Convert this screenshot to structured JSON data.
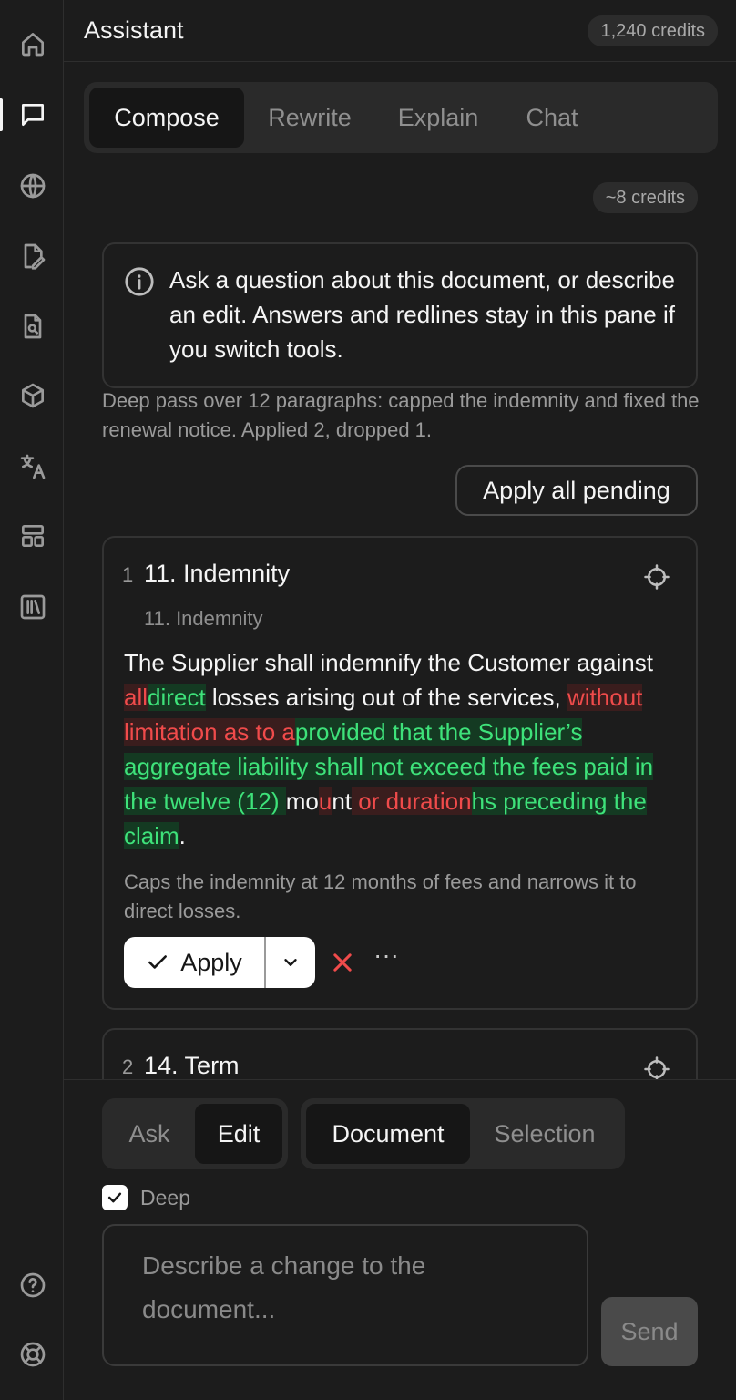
{
  "header": {
    "title": "Assistant",
    "credits": "1,240 credits"
  },
  "tabs": [
    {
      "label": "Compose",
      "active": true
    },
    {
      "label": "Rewrite",
      "active": false
    },
    {
      "label": "Explain",
      "active": false
    },
    {
      "label": "Chat",
      "active": false
    }
  ],
  "estimate": "~8 credits",
  "info": "Ask a question about this document, or describe an edit. Answers and redlines stay in this pane if you switch tools.",
  "summary": "Deep pass over 12 paragraphs: capped the indemnity and fixed the renewal notice. Applied 2, dropped 1.",
  "apply_all_label": "Apply all pending",
  "cards": [
    {
      "number": "1",
      "title": "11. Indemnity",
      "subtitle": "11. Indemnity",
      "body": [
        {
          "t": "The Supplier shall indemnify the Customer against ",
          "k": "plain"
        },
        {
          "t": "all",
          "k": "del"
        },
        {
          "t": "direct",
          "k": "ins"
        },
        {
          "t": " losses arising out of the services, ",
          "k": "plain"
        },
        {
          "t": "without limitation as to a",
          "k": "del"
        },
        {
          "t": "provided that the Supplier’s aggregate liability shall not exceed the fees paid in the twelve (12) ",
          "k": "ins"
        },
        {
          "t": "mo",
          "k": "plain"
        },
        {
          "t": "u",
          "k": "del"
        },
        {
          "t": "nt",
          "k": "plain"
        },
        {
          "t": " or duration",
          "k": "del"
        },
        {
          "t": "hs preceding the claim",
          "k": "ins"
        },
        {
          "t": ".",
          "k": "plain"
        }
      ],
      "reason": "Caps the indemnity at 12 months of fees and narrows it to direct losses.",
      "apply_label": "Apply",
      "more_label": "···"
    },
    {
      "number": "2",
      "title": "14. Term"
    }
  ],
  "composer": {
    "mode": [
      {
        "label": "Ask",
        "active": false
      },
      {
        "label": "Edit",
        "active": true
      }
    ],
    "scope": [
      {
        "label": "Document",
        "active": true
      },
      {
        "label": "Selection",
        "active": false
      }
    ],
    "deep_label": "Deep",
    "deep_checked": true,
    "placeholder": "Describe a change to the document...",
    "send_label": "Send"
  },
  "colors": {
    "deletion": "#f04b4b",
    "insertion": "#3ee27a",
    "background": "#1c1c1c"
  }
}
